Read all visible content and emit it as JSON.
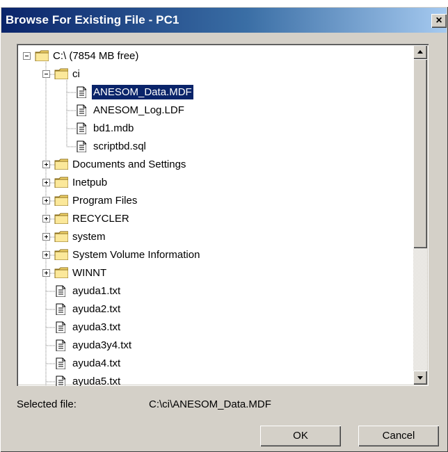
{
  "window": {
    "title": "Browse For Existing File - PC1",
    "close_glyph": "×"
  },
  "tree": {
    "items": [
      {
        "label": "C:\\ (7854 MB free)",
        "type": "folder",
        "level": 0,
        "expander": "minus"
      },
      {
        "label": "ci",
        "type": "folder",
        "level": 1,
        "expander": "minus"
      },
      {
        "label": "ANESOM_Data.MDF",
        "type": "file",
        "level": 2,
        "selected": true
      },
      {
        "label": "ANESOM_Log.LDF",
        "type": "file",
        "level": 2
      },
      {
        "label": "bd1.mdb",
        "type": "file",
        "level": 2
      },
      {
        "label": "scriptbd.sql",
        "type": "file",
        "level": 2
      },
      {
        "label": "Documents and Settings",
        "type": "folder",
        "level": 1,
        "expander": "plus"
      },
      {
        "label": "Inetpub",
        "type": "folder",
        "level": 1,
        "expander": "plus"
      },
      {
        "label": "Program Files",
        "type": "folder",
        "level": 1,
        "expander": "plus"
      },
      {
        "label": "RECYCLER",
        "type": "folder",
        "level": 1,
        "expander": "plus"
      },
      {
        "label": "system",
        "type": "folder",
        "level": 1,
        "expander": "plus"
      },
      {
        "label": "System Volume Information",
        "type": "folder",
        "level": 1,
        "expander": "plus"
      },
      {
        "label": "WINNT",
        "type": "folder",
        "level": 1,
        "expander": "plus"
      },
      {
        "label": "ayuda1.txt",
        "type": "file",
        "level": 1
      },
      {
        "label": "ayuda2.txt",
        "type": "file",
        "level": 1
      },
      {
        "label": "ayuda3.txt",
        "type": "file",
        "level": 1
      },
      {
        "label": "ayuda3y4.txt",
        "type": "file",
        "level": 1
      },
      {
        "label": "ayuda4.txt",
        "type": "file",
        "level": 1
      },
      {
        "label": "ayuda5.txt",
        "type": "file",
        "level": 1
      }
    ]
  },
  "status": {
    "label": "Selected file:",
    "value": "C:\\ci\\ANESOM_Data.MDF"
  },
  "buttons": {
    "ok": "OK",
    "cancel": "Cancel"
  },
  "colors": {
    "title_bar": "#0a246a",
    "selection": "#0a246a",
    "folder": "#f5d76e"
  },
  "icons": {
    "folder": "folder-icon",
    "file": "file-icon",
    "expand": "plus-box-icon",
    "collapse": "minus-box-icon",
    "scroll_up": "arrow-up-icon",
    "scroll_down": "arrow-down-icon",
    "close": "close-icon"
  }
}
